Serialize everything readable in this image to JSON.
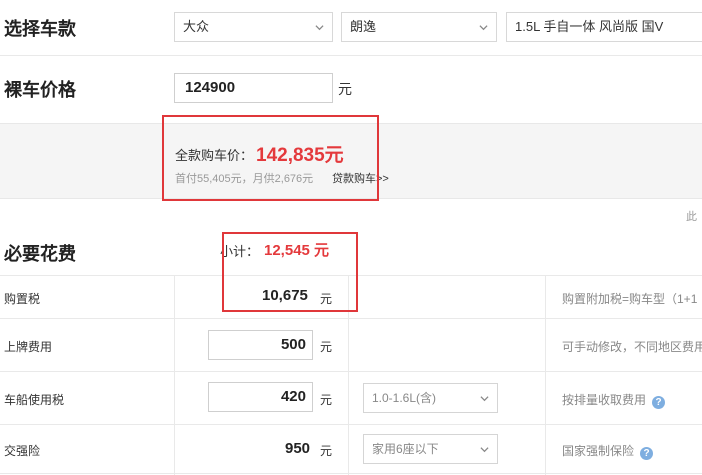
{
  "select_car": {
    "title": "选择车款",
    "brand": "大众",
    "series": "朗逸",
    "model": "1.5L 手自一体 风尚版 国V"
  },
  "bare_price": {
    "title": "裸车价格",
    "value": "124900",
    "unit": "元"
  },
  "full_price": {
    "label": "全款购车价：",
    "value": "142,835元",
    "loan_text": "首付55,405元，月供2,676元",
    "loan_link": "贷款购车>>",
    "side_text": "此"
  },
  "required_fees": {
    "title": "必要花费",
    "subtotal_label": "小计：",
    "subtotal_value": "12,545 元"
  },
  "rows": [
    {
      "label": "购置税",
      "value": "10,675",
      "unit": "元",
      "note": "购置附加税=购车型（1+1"
    },
    {
      "label": "上牌费用",
      "value": "500",
      "unit": "元",
      "note": "可手动修改，不同地区费用"
    },
    {
      "label": "车船使用税",
      "value": "420",
      "unit": "元",
      "option": "1.0-1.6L(含)",
      "note": "按排量收取费用"
    },
    {
      "label": "交强险",
      "value": "950",
      "unit": "元",
      "option": "家用6座以下",
      "note": "国家强制保险"
    }
  ],
  "colors": {
    "accent_red": "#e0373a",
    "price_red": "#e4393c"
  }
}
